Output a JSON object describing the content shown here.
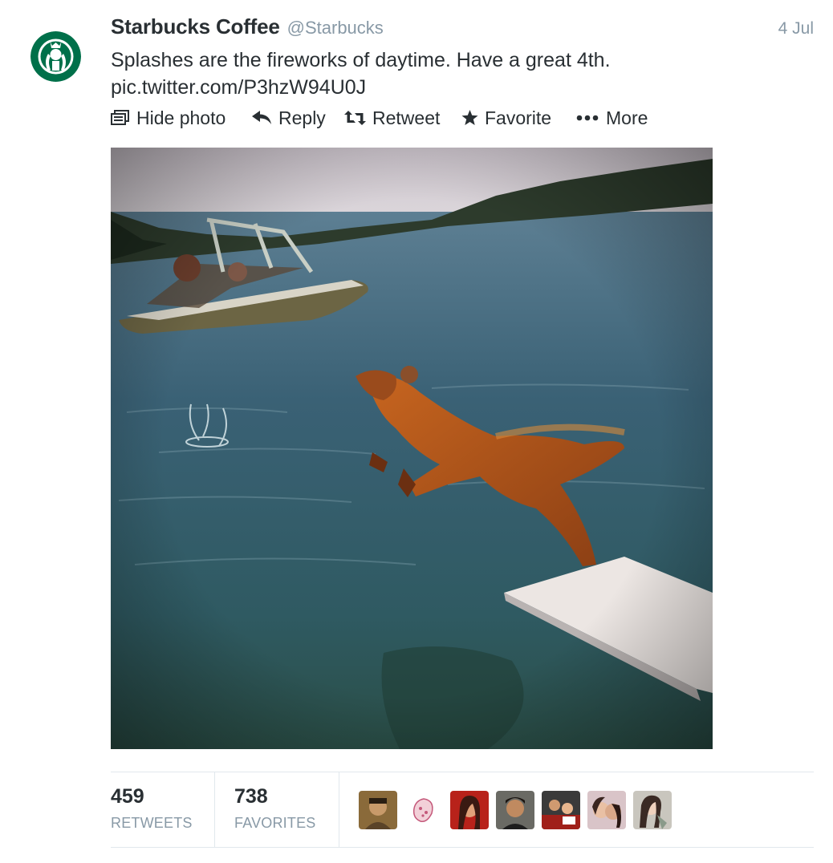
{
  "tweet": {
    "author_name": "Starbucks Coffee",
    "author_handle": "@Starbucks",
    "date": "4 Jul",
    "text_line1": "Splashes are the fireworks of daytime. Have a great 4th.",
    "link": "pic.twitter.com/P3hzW94U0J"
  },
  "actions": {
    "hide_photo": "Hide photo",
    "reply": "Reply",
    "retweet": "Retweet",
    "favorite": "Favorite",
    "more": "More"
  },
  "stats": {
    "retweets_count": "459",
    "retweets_label": "RETWEETS",
    "favorites_count": "738",
    "favorites_label": "FAVORITES"
  },
  "icons": {
    "hide_photo": "photo-frame-icon",
    "reply": "reply-arrow-icon",
    "retweet": "retweet-icon",
    "favorite": "star-icon",
    "more": "ellipsis-icon"
  },
  "colors": {
    "brand_green": "#00704a",
    "text": "#292f33",
    "muted": "#8899a6",
    "border": "#e1e8ed"
  }
}
